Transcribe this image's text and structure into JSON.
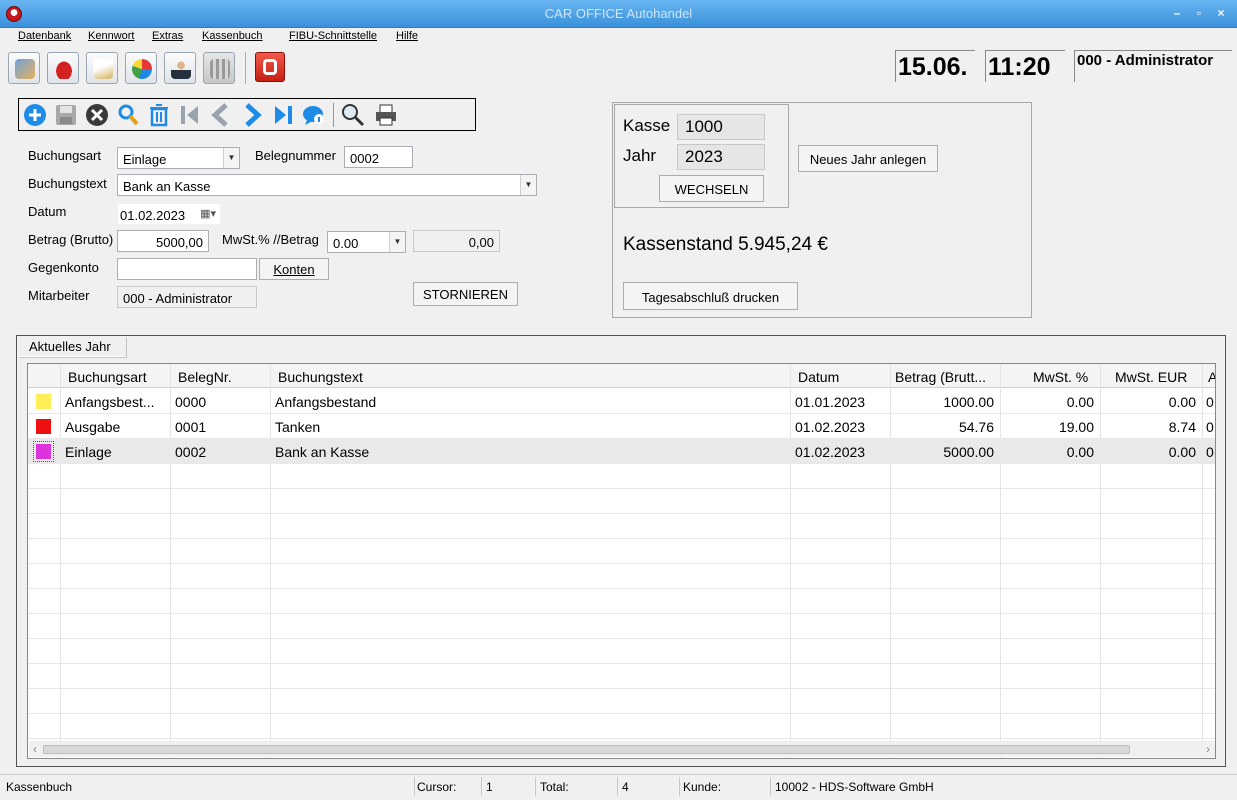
{
  "window": {
    "title": "CAR OFFICE Autohandel",
    "min": "–",
    "max": "▫",
    "close": "×"
  },
  "menu": [
    "Datenbank",
    "Kennwort",
    "Extras",
    "Kassenbuch",
    "FIBU-Schnittstelle",
    "Hilfe"
  ],
  "header": {
    "date": "15.06.",
    "time": "11:20",
    "user": "000 - Administrator"
  },
  "toolbar_icons": [
    "contacts-icon",
    "car-icon",
    "documents-icon",
    "pie-chart-icon",
    "person-icon",
    "building-icon"
  ],
  "form": {
    "buchungsart_label": "Buchungsart",
    "buchungsart": "Einlage",
    "belegnummer_label": "Belegnummer",
    "belegnummer": "0002",
    "buchungstext_label": "Buchungstext",
    "buchungstext": "Bank an Kasse",
    "datum_label": "Datum",
    "datum": "01.02.2023",
    "betrag_label": "Betrag (Brutto)",
    "betrag": "5000,00",
    "mwst_label": "MwSt.% //Betrag",
    "mwst": "0.00",
    "mwst_betrag": "0,00",
    "gegenkonto_label": "Gegenkonto",
    "gegenkonto": "",
    "konten_button": "Konten",
    "mitarbeiter_label": "Mitarbeiter",
    "mitarbeiter": "000 - Administrator",
    "stornieren_button": "STORNIEREN"
  },
  "kasse": {
    "kasse_label": "Kasse",
    "kasse": "1000",
    "jahr_label": "Jahr",
    "jahr": "2023",
    "wechseln_button": "WECHSELN",
    "neues_jahr_button": "Neues Jahr anlegen",
    "kassenstand": "Kassenstand  5.945,24 €",
    "tagesabschluss_button": "Tagesabschluß drucken"
  },
  "tab": "Aktuelles Jahr",
  "table": {
    "columns": [
      "Buchungsart",
      "BelegNr.",
      "Buchungstext",
      "Datum",
      "Betrag (Brutt...",
      "MwSt. %",
      "MwSt. EUR",
      "A"
    ],
    "rows": [
      {
        "color": "#ffee58",
        "cells": [
          "Anfangsbest...",
          "0000",
          "Anfangsbestand",
          "01.01.2023",
          "1000.00",
          "0.00",
          "0.00",
          "0"
        ]
      },
      {
        "color": "#ee1111",
        "cells": [
          "Ausgabe",
          "0001",
          "Tanken",
          "01.02.2023",
          "54.76",
          "19.00",
          "8.74",
          "0"
        ]
      },
      {
        "color": "#dd33dd",
        "cells": [
          "Einlage",
          "0002",
          "Bank an Kasse",
          "01.02.2023",
          "5000.00",
          "0.00",
          "0.00",
          "0"
        ]
      }
    ]
  },
  "status": {
    "module": "Kassenbuch",
    "cursor_label": "Cursor:",
    "cursor": "1",
    "total_label": "Total:",
    "total": "4",
    "kunde_label": "Kunde:",
    "kunde": "10002 - HDS-Software GmbH"
  }
}
